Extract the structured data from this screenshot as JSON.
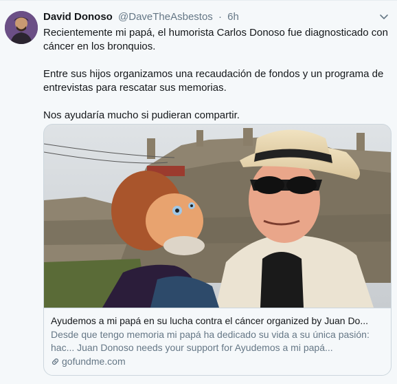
{
  "tweet": {
    "author_name": "David Donoso",
    "author_handle": "@DaveTheAsbestos",
    "separator": "·",
    "time": "6h",
    "paragraphs": [
      "Recientemente mi papá, el humorista Carlos Donoso fue diagnosticado con cáncer en los bronquios.",
      "Entre sus hijos organizamos una recaudación de fondos y un programa de entrevistas para rescatar sus memorias.",
      "Nos ayudaría mucho si pudieran compartir."
    ]
  },
  "card": {
    "title": "Ayudemos a mi papá en su lucha contra el cáncer organized by Juan Do...",
    "description": "Desde que tengo memoria mi papá ha dedicado su vida a su única pasión: hac... Juan Donoso needs your support for Ayudemos a mi papá...",
    "domain": "gofundme.com",
    "link_icon": "link-icon"
  },
  "icons": {
    "more": "chevron-down-icon",
    "avatar": "avatar"
  },
  "colors": {
    "background": "#f5f8fa",
    "text_primary": "#14171a",
    "text_secondary": "#657786",
    "border": "#ccd6dd"
  }
}
